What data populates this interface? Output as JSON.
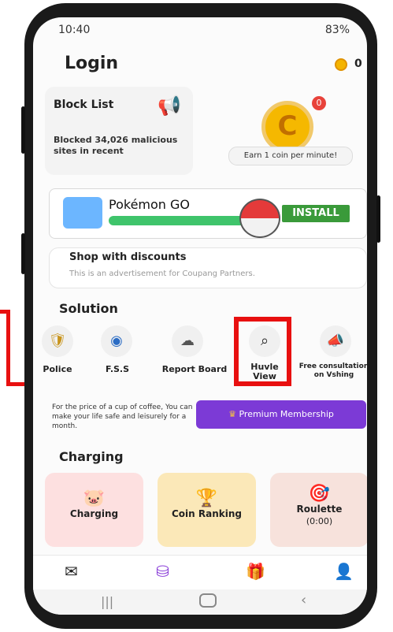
{
  "status_bar": {
    "time": "10:40",
    "battery": "83%"
  },
  "header": {
    "title": "Login",
    "coin_count": "0"
  },
  "block_list": {
    "title": "Block List",
    "text": "Blocked 34,026 malicious sites in recent"
  },
  "coin_card": {
    "badge": "0",
    "earn_label": "Earn 1 coin per minute!"
  },
  "ad": {
    "app_name": "Pokémon GO",
    "install_label": "INSTALL"
  },
  "shop": {
    "title": "Shop with discounts",
    "subtitle": "This is an advertisement for Coupang Partners."
  },
  "solution": {
    "title": "Solution",
    "items": [
      {
        "label": "Police",
        "icon": "police-emblem-icon"
      },
      {
        "label": "F.S.S",
        "icon": "fss-emblem-icon"
      },
      {
        "label": "Report Board",
        "icon": "report-board-icon"
      },
      {
        "label": "Huvle View",
        "icon": "search-icon"
      },
      {
        "label": "Free consultation on Vshing",
        "icon": "megaphone-icon"
      }
    ]
  },
  "premium": {
    "note": "For the price of a cup of coffee, You can make your life safe and leisurely for a month.",
    "button_label": "Premium Membership"
  },
  "charging": {
    "title": "Charging",
    "tiles": [
      {
        "label": "Charging",
        "icon": "piggy-bank-icon",
        "color": "#fde0e0"
      },
      {
        "label": "Coin Ranking",
        "icon": "trophy-icon",
        "color": "#fbe8b8"
      },
      {
        "label": "Roulette",
        "sub": "(0:00)",
        "icon": "target-icon",
        "color": "#f7e2dc"
      }
    ]
  },
  "bottom_nav": [
    "mail-icon",
    "hand-coin-icon",
    "gift-icon",
    "profile-icon"
  ],
  "colors": {
    "accent": "#7c3ad6",
    "highlight": "#e81010",
    "install": "#3a9a3a"
  }
}
